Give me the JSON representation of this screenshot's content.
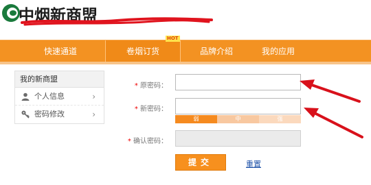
{
  "header": {
    "logo_text": "中烟新商盟",
    "logo_icon": "leaf-c-logo",
    "scribble_color": "#e0141e"
  },
  "nav": {
    "items": [
      {
        "label": "快速通道"
      },
      {
        "label": "卷烟订货"
      },
      {
        "label": "品牌介绍"
      },
      {
        "label": "我的应用"
      }
    ],
    "active_index": 1,
    "hot_badge": "HOT",
    "color": "#f39222"
  },
  "sidebar": {
    "title": "我的新商盟",
    "items": [
      {
        "label": "个人信息",
        "icon": "person-icon",
        "chevron": "›"
      },
      {
        "label": "密码修改",
        "icon": "key-icon",
        "chevron": "›"
      }
    ]
  },
  "form": {
    "required_mark": "*",
    "old_password_label": "原密码：",
    "new_password_label": "新密码：",
    "confirm_password_label": "确认密码：",
    "old_password_value": "",
    "new_password_value": "",
    "confirm_password_value": "",
    "strength": [
      "弱",
      "中",
      "强"
    ],
    "submit_label": "提交",
    "reset_label": "重置"
  },
  "annotations": {
    "arrow_color": "#d8111b",
    "arrow_count": 2
  }
}
